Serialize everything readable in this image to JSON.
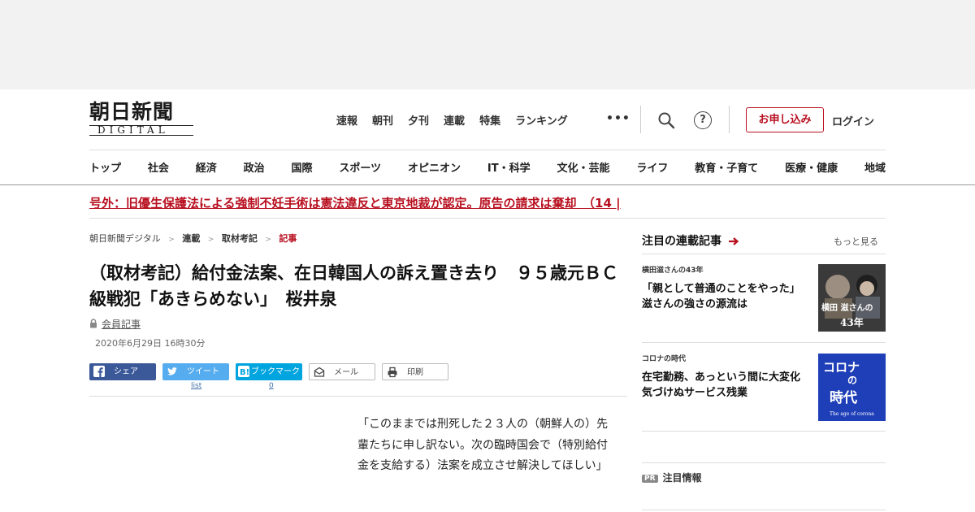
{
  "header": {
    "logo_main": "朝日新聞",
    "logo_sub": "DIGITAL",
    "top_nav": [
      "速報",
      "朝刊",
      "夕刊",
      "連載",
      "特集",
      "ランキング"
    ],
    "more": "•••",
    "help": "?",
    "apply_label": "お申し込み",
    "login_label": "ログイン"
  },
  "category_nav": [
    "トップ",
    "社会",
    "経済",
    "政治",
    "国際",
    "スポーツ",
    "オピニオン",
    "IT・科学",
    "文化・芸能",
    "ライフ",
    "教育・子育て",
    "医療・健康",
    "地域"
  ],
  "breaking": "号外：旧優生保護法による強制不妊手術は憲法違反と東京地裁が認定。原告の請求は棄却　（14 |",
  "breadcrumb": {
    "items": [
      "朝日新聞デジタル",
      "連載",
      "取材考記"
    ],
    "current": "記事",
    "sep": ">"
  },
  "article": {
    "title": "（取材考記）給付金法案、在日韓国人の訴え置き去り　９５歳元ＢＣ級戦犯「あきらめない」　桜井泉",
    "member_label": "会員記事",
    "date": "2020年6月29日 16時30分",
    "body": "「このままでは刑死した２３人の（朝鮮人の）先輩たちに申し訳ない。次の臨時国会で（特別給付金を支給する）法案を成立させ解決してほしい」"
  },
  "share": {
    "facebook": "シェア",
    "twitter": "ツイート",
    "hatena": "ブックマーク",
    "mail": "メール",
    "print": "印刷",
    "twitter_count": "list",
    "hatena_count": "0",
    "colors": {
      "facebook": "#3b5998",
      "twitter": "#55acee",
      "hatena": "#00a4de"
    }
  },
  "sidebar": {
    "heading": "注目の連載記事",
    "more_label": "もっと見る",
    "items": [
      {
        "category": "横田滋さんの43年",
        "title": "「親として普通のことをやった」　滋さんの強さの源流は",
        "thumb_text_1": "横田 滋さんの",
        "thumb_text_2": "43年"
      },
      {
        "category": "コロナの時代",
        "title": "在宅勤務、あっという間に大変化　気づけぬサービス残業",
        "thumb_text_1": "コロナ",
        "thumb_text_2": "の",
        "thumb_text_3": "時代",
        "thumb_text_4": "The age of corona"
      }
    ],
    "pr_badge": "PR",
    "pr_label": "注目情報"
  },
  "colors": {
    "accent": "#b80f1f",
    "ad_band": "#f2f2f2"
  }
}
